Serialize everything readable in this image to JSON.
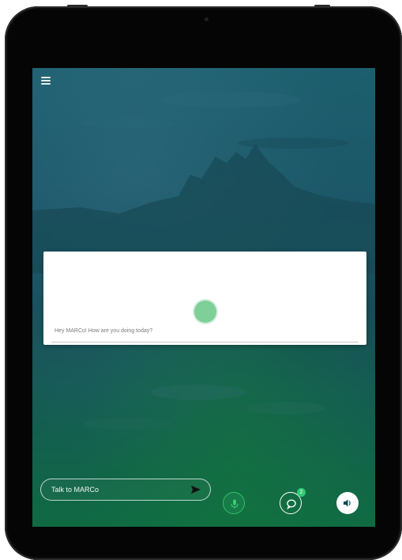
{
  "app": {
    "assistant_name": "MARCo"
  },
  "card": {
    "message": "Hey MARCo! How are you doing today?"
  },
  "input": {
    "placeholder": "Talk to MARCo"
  },
  "chat": {
    "badge_count": "2"
  },
  "colors": {
    "accent_green": "#2ecc71",
    "orb": "#7ecf98"
  },
  "icons": [
    "menu-icon",
    "send-icon",
    "microphone-icon",
    "chat-bubble-icon",
    "speaker-icon"
  ]
}
